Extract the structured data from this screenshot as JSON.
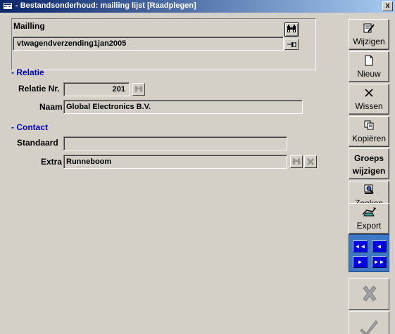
{
  "window": {
    "title": "- Bestandsonderhoud: mailiing lijst [Raadplegen]",
    "close_label": "x"
  },
  "mailing": {
    "label": "Mailling",
    "value": "vtwagendverzending1jan2005"
  },
  "relatie": {
    "section_title": "- Relatie",
    "nr_label": "Relatie Nr.",
    "nr_value": "201",
    "naam_label": "Naam",
    "naam_value": "Global Electronics B.V."
  },
  "contact": {
    "section_title": "- Contact",
    "standaard_label": "Standaard",
    "standaard_value": "",
    "extra_label": "Extra",
    "extra_value": "Runneboom"
  },
  "toolbar": {
    "wijzigen": "Wijzigen",
    "nieuw": "Nieuw",
    "wissen": "Wissen",
    "kopieren": "Kopiëren",
    "groeps_line1": "Groeps",
    "groeps_line2": "wijzigen",
    "zoeken": "Zoeken",
    "export": "Export"
  },
  "navigation": {
    "first": "◄◄",
    "prev": "◄",
    "next": "►",
    "last": "►►"
  },
  "colors": {
    "title_start": "#0a246a",
    "title_end": "#a6caf0",
    "section": "#0000c0",
    "nav_panel": "#3c78c4",
    "nav_button": "#0000e0",
    "face": "#d4d0c8"
  },
  "icons": [
    "window-icon",
    "binoculars-icon",
    "pin-icon",
    "edit-icon",
    "new-document-icon",
    "delete-x-icon",
    "copy-icon",
    "search-document-icon",
    "export-icon",
    "cancel-icon",
    "confirm-icon"
  ]
}
